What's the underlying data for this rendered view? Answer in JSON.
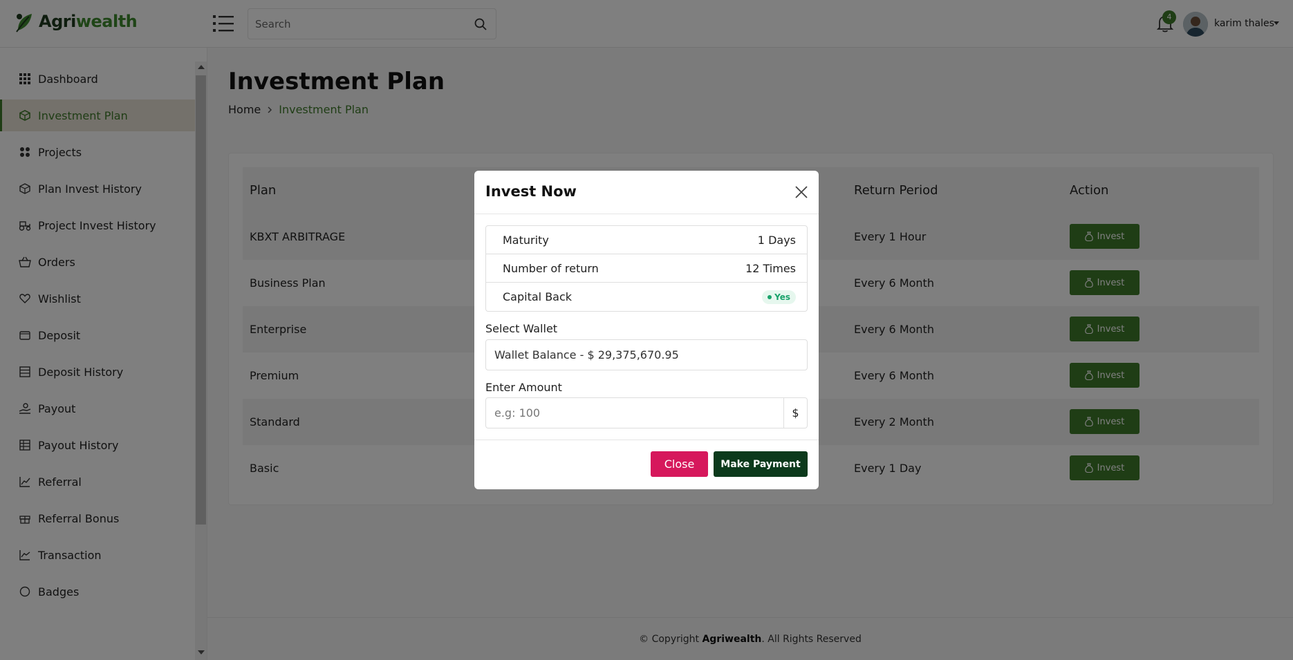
{
  "header": {
    "brand_part1": "Agri",
    "brand_part2": "wealth",
    "search_placeholder": "Search",
    "notification_count": "4",
    "user_name": "karim thales"
  },
  "sidebar": {
    "items": [
      {
        "label": "Dashboard",
        "icon": "grid-icon"
      },
      {
        "label": "Investment Plan",
        "icon": "cube-icon",
        "active": true
      },
      {
        "label": "Projects",
        "icon": "puzzle-icon"
      },
      {
        "label": "Plan Invest History",
        "icon": "box-icon"
      },
      {
        "label": "Project Invest History",
        "icon": "tractor-icon"
      },
      {
        "label": "Orders",
        "icon": "basket-icon"
      },
      {
        "label": "Wishlist",
        "icon": "heart-icon"
      },
      {
        "label": "Deposit",
        "icon": "wallet-icon"
      },
      {
        "label": "Deposit History",
        "icon": "list-icon"
      },
      {
        "label": "Payout",
        "icon": "hand-coin-icon"
      },
      {
        "label": "Payout History",
        "icon": "table-icon"
      },
      {
        "label": "Referral",
        "icon": "chart-line-icon"
      },
      {
        "label": "Referral Bonus",
        "icon": "gift-icon"
      },
      {
        "label": "Transaction",
        "icon": "trend-icon"
      },
      {
        "label": "Badges",
        "icon": "badge-icon"
      }
    ]
  },
  "main": {
    "title": "Investment Plan",
    "breadcrumb_home": "Home",
    "breadcrumb_current": "Investment Plan",
    "table": {
      "headers": {
        "plan": "Plan",
        "return_period": "Return Period",
        "action": "Action"
      },
      "rows": [
        {
          "plan": "KBXT ARBITRAGE",
          "return_period": "Every 1 Hour",
          "action": "Invest"
        },
        {
          "plan": "Business Plan",
          "return_period": "Every 6 Month",
          "action": "Invest"
        },
        {
          "plan": "Enterprise",
          "return_period": "Every 6 Month",
          "action": "Invest"
        },
        {
          "plan": "Premium",
          "return_period": "Every 6 Month",
          "action": "Invest"
        },
        {
          "plan": "Standard",
          "return_period": "Every 2 Month",
          "action": "Invest"
        },
        {
          "plan": "Basic",
          "return_period": "Every 1 Day",
          "action": "Invest"
        }
      ]
    }
  },
  "footer": {
    "prefix": "© Copyright ",
    "brand": "Agriwealth",
    "suffix": ". All Rights Reserved"
  },
  "modal": {
    "title": "Invest Now",
    "info": {
      "maturity_label": "Maturity",
      "maturity_value": "1 Days",
      "returns_label": "Number of return",
      "returns_value": "12 Times",
      "capital_label": "Capital Back",
      "capital_value": "Yes"
    },
    "wallet_label": "Select Wallet",
    "wallet_value": "Wallet Balance - $ 29,375,670.95",
    "amount_label": "Enter Amount",
    "amount_placeholder": "e.g: 100",
    "currency": "$",
    "close_label": "Close",
    "pay_label": "Make Payment"
  },
  "colors": {
    "brand_green": "#3e7a2b",
    "dark_green": "#0c3a1c",
    "close_red": "#d6185c",
    "active_bg": "#e9e2d6",
    "yes_green": "#1aa36b"
  }
}
